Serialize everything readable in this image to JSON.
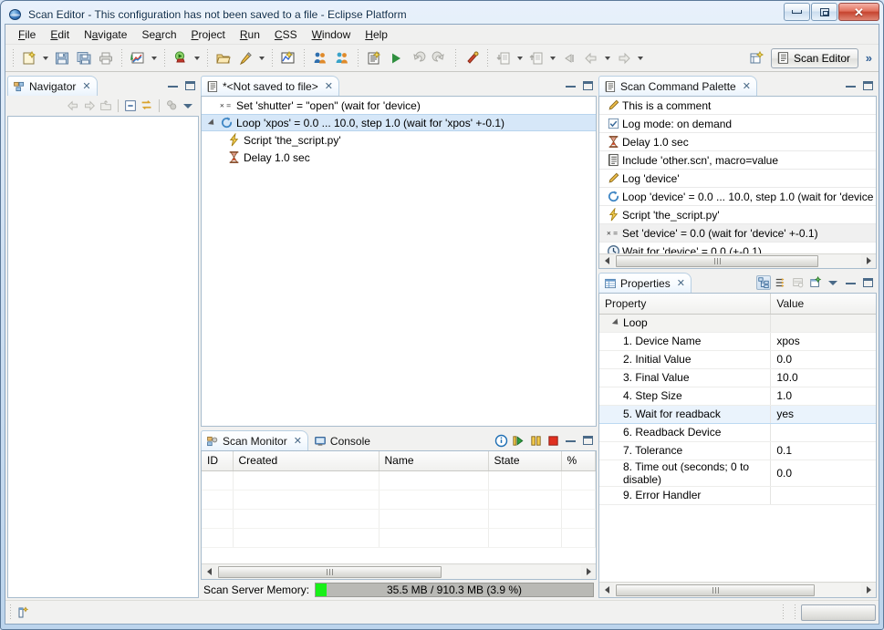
{
  "window": {
    "title": "Scan Editor - This configuration has not been saved to a file - Eclipse Platform",
    "app_icon": "eclipse-globe-icon",
    "minimize_label": "Minimize",
    "restore_label": "Restore",
    "close_label": "Close"
  },
  "menubar": {
    "items": [
      {
        "label": "File",
        "mnemonic": "F"
      },
      {
        "label": "Edit",
        "mnemonic": "E"
      },
      {
        "label": "Navigate",
        "mnemonic": "N"
      },
      {
        "label": "Search",
        "mnemonic": "a"
      },
      {
        "label": "Project",
        "mnemonic": "P"
      },
      {
        "label": "Run",
        "mnemonic": "R"
      },
      {
        "label": "CSS",
        "mnemonic": "C"
      },
      {
        "label": "Window",
        "mnemonic": "W"
      },
      {
        "label": "Help",
        "mnemonic": "H"
      }
    ]
  },
  "toolbar": {
    "groups": [
      [
        "new-wizard-icon",
        "new-wizard-dropdown",
        "save-icon",
        "save-all-icon",
        "print-icon"
      ],
      [
        "plot-data-browser-icon",
        "plot-dropdown"
      ],
      [
        "run-scan-icon",
        "run-dropdown"
      ],
      [
        "open-folder-icon",
        "pen-edit-icon",
        "pen-dropdown"
      ],
      [
        "scan-plot-icon"
      ],
      [
        "orange-person-icon",
        "blue-person-icon"
      ],
      [
        "new-scan-editor-icon",
        "run-play-icon",
        "undo-arrow-icon",
        "redo-arrow-icon"
      ],
      [
        "wand-icon"
      ],
      [
        "import-icon",
        "import-dropdown",
        "export-icon",
        "export-dropdown",
        "back-history-icon",
        "back-arrow-icon",
        "back-dropdown",
        "forward-arrow-icon",
        "forward-dropdown"
      ]
    ],
    "perspective": {
      "label": "Scan Editor",
      "icon": "scan-editor-icon",
      "open-perspective-icon": "open-perspective-icon"
    },
    "overflow": "»"
  },
  "navigator": {
    "tab_label": "Navigator",
    "tab_icon": "navigator-icon",
    "close_glyph": "✕",
    "tools": [
      "back-icon",
      "forward-icon",
      "up-icon",
      "collapse-all-icon",
      "link-with-editor-icon",
      "filters-icon",
      "view-menu-icon"
    ],
    "items": []
  },
  "editor": {
    "tab_label": "*<Not saved to file>",
    "tab_icon": "scan-editor-icon",
    "close_glyph": "✕",
    "tree": [
      {
        "icon": "set-command-icon",
        "label": "Set 'shutter' = \"open\" (wait for 'device)",
        "indent": 0,
        "selected": false,
        "expandable": false
      },
      {
        "icon": "loop-command-icon",
        "label": "Loop 'xpos' = 0.0 ... 10.0, step 1.0 (wait for 'xpos' +-0.1)",
        "indent": 0,
        "selected": true,
        "expandable": true
      },
      {
        "icon": "script-command-icon",
        "label": "Script 'the_script.py'",
        "indent": 1,
        "selected": false,
        "expandable": false
      },
      {
        "icon": "delay-command-icon",
        "label": "Delay 1.0 sec",
        "indent": 1,
        "selected": false,
        "expandable": false
      }
    ]
  },
  "palette": {
    "tab_label": "Scan Command Palette",
    "tab_icon": "scan-editor-icon",
    "close_glyph": "✕",
    "items": [
      {
        "icon": "comment-command-icon",
        "label": "This is a comment",
        "selected": false
      },
      {
        "icon": "log-mode-command-icon",
        "label": "Log mode: on demand",
        "selected": false
      },
      {
        "icon": "delay-command-icon",
        "label": "Delay 1.0 sec",
        "selected": false
      },
      {
        "icon": "include-command-icon",
        "label": "Include 'other.scn', macro=value",
        "selected": false
      },
      {
        "icon": "log-command-icon",
        "label": "Log 'device'",
        "selected": false
      },
      {
        "icon": "loop-command-icon",
        "label": "Loop 'device' = 0.0 ... 10.0, step 1.0 (wait for 'device",
        "selected": false
      },
      {
        "icon": "script-command-icon",
        "label": "Script 'the_script.py'",
        "selected": false
      },
      {
        "icon": "set-command-icon",
        "label": "Set 'device' = 0.0 (wait for 'device' +-0.1)",
        "selected": true
      },
      {
        "icon": "wait-command-icon",
        "label": "Wait for 'device' = 0.0 (+-0.1)",
        "selected": false
      }
    ]
  },
  "properties": {
    "tab_label": "Properties",
    "tab_icon": "properties-icon",
    "close_glyph": "✕",
    "tools": [
      "show-categories-icon",
      "show-advanced-icon",
      "restore-default-icon",
      "new-tab-icon",
      "view-menu-icon",
      "minimize-icon",
      "maximize-icon"
    ],
    "columns": [
      "Property",
      "Value"
    ],
    "group_label": "Loop",
    "rows": [
      {
        "property": "1. Device Name",
        "value": "xpos",
        "selected": false
      },
      {
        "property": "2. Initial Value",
        "value": "0.0",
        "selected": false
      },
      {
        "property": "3. Final Value",
        "value": "10.0",
        "selected": false
      },
      {
        "property": "4. Step Size",
        "value": "1.0",
        "selected": false
      },
      {
        "property": "5. Wait for readback",
        "value": "yes",
        "selected": true
      },
      {
        "property": "6. Readback Device",
        "value": "",
        "selected": false
      },
      {
        "property": "7. Tolerance",
        "value": "0.1",
        "selected": false
      },
      {
        "property": "8. Time out (seconds; 0 to disable)",
        "value": "0.0",
        "selected": false
      },
      {
        "property": "9. Error Handler",
        "value": "",
        "selected": false
      }
    ]
  },
  "monitor": {
    "tabs": [
      {
        "label": "Scan Monitor",
        "icon": "scan-monitor-icon",
        "active": true,
        "close_glyph": "✕"
      },
      {
        "label": "Console",
        "icon": "console-icon",
        "active": false
      }
    ],
    "tools": [
      "info-icon",
      "resume-icon",
      "pause-icon",
      "stop-icon",
      "minimize-icon",
      "maximize-icon"
    ],
    "columns": [
      "ID",
      "Created",
      "Name",
      "State",
      "%"
    ],
    "rows": [],
    "memory": {
      "label": "Scan Server Memory:",
      "text": "35.5 MB / 910.3 MB (3.9 %)",
      "percent": 3.9,
      "fill_color": "#18f018"
    }
  },
  "statusbar": {
    "icon": "status-editor-icon"
  }
}
